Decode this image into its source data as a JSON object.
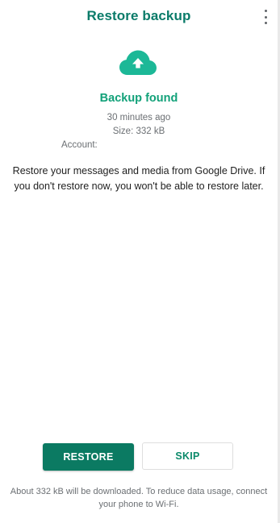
{
  "header": {
    "title": "Restore backup",
    "menu_icon": "more-vert-icon"
  },
  "backup": {
    "icon": "cloud-upload-icon",
    "status": "Backup found",
    "time": "30 minutes ago",
    "size": "Size: 332 kB",
    "account_label": "Account:"
  },
  "description": "Restore your messages and media from Google Drive. If you don't restore now, you won't be able to restore later.",
  "actions": {
    "restore_label": "RESTORE",
    "skip_label": "SKIP"
  },
  "footnote": "About 332 kB will be downloaded. To reduce data usage, connect your phone to Wi-Fi.",
  "colors": {
    "accent": "#0a7b69",
    "accent_light": "#1cb897",
    "button": "#0b7a62"
  }
}
